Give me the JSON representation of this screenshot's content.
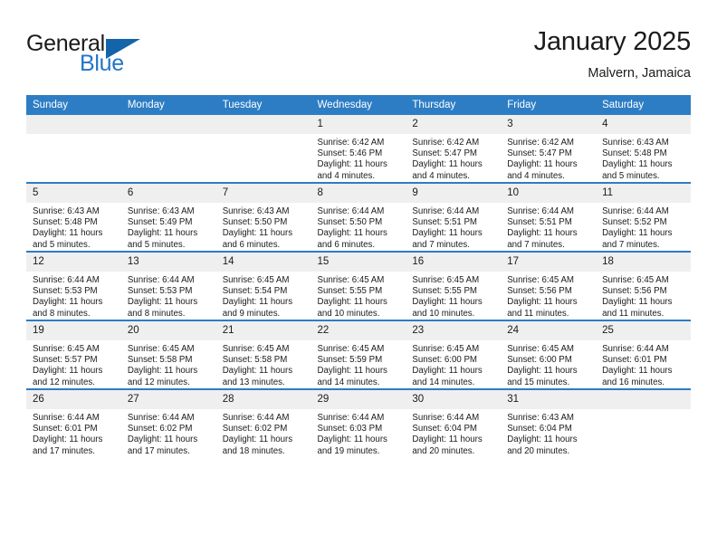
{
  "brand": {
    "name_part1": "General",
    "name_part2": "Blue",
    "triangle_icon": "triangle-icon",
    "accent_color": "#2176c7",
    "triangle_color": "#1464aa"
  },
  "header": {
    "title": "January 2025",
    "subtitle": "Malvern, Jamaica"
  },
  "theme": {
    "header_blue": "#2d7dc4",
    "daynum_band": "#efefef",
    "text": "#1b1b1b"
  },
  "weekday_headers": [
    "Sunday",
    "Monday",
    "Tuesday",
    "Wednesday",
    "Thursday",
    "Friday",
    "Saturday"
  ],
  "labels": {
    "sunrise": "Sunrise:",
    "sunset": "Sunset:",
    "daylight": "Daylight:"
  },
  "weeks": [
    [
      {
        "day": "",
        "sunrise": "",
        "sunset": "",
        "daylight1": "",
        "daylight2": ""
      },
      {
        "day": "",
        "sunrise": "",
        "sunset": "",
        "daylight1": "",
        "daylight2": ""
      },
      {
        "day": "",
        "sunrise": "",
        "sunset": "",
        "daylight1": "",
        "daylight2": ""
      },
      {
        "day": "1",
        "sunrise": "Sunrise: 6:42 AM",
        "sunset": "Sunset: 5:46 PM",
        "daylight1": "Daylight: 11 hours",
        "daylight2": "and 4 minutes."
      },
      {
        "day": "2",
        "sunrise": "Sunrise: 6:42 AM",
        "sunset": "Sunset: 5:47 PM",
        "daylight1": "Daylight: 11 hours",
        "daylight2": "and 4 minutes."
      },
      {
        "day": "3",
        "sunrise": "Sunrise: 6:42 AM",
        "sunset": "Sunset: 5:47 PM",
        "daylight1": "Daylight: 11 hours",
        "daylight2": "and 4 minutes."
      },
      {
        "day": "4",
        "sunrise": "Sunrise: 6:43 AM",
        "sunset": "Sunset: 5:48 PM",
        "daylight1": "Daylight: 11 hours",
        "daylight2": "and 5 minutes."
      }
    ],
    [
      {
        "day": "5",
        "sunrise": "Sunrise: 6:43 AM",
        "sunset": "Sunset: 5:48 PM",
        "daylight1": "Daylight: 11 hours",
        "daylight2": "and 5 minutes."
      },
      {
        "day": "6",
        "sunrise": "Sunrise: 6:43 AM",
        "sunset": "Sunset: 5:49 PM",
        "daylight1": "Daylight: 11 hours",
        "daylight2": "and 5 minutes."
      },
      {
        "day": "7",
        "sunrise": "Sunrise: 6:43 AM",
        "sunset": "Sunset: 5:50 PM",
        "daylight1": "Daylight: 11 hours",
        "daylight2": "and 6 minutes."
      },
      {
        "day": "8",
        "sunrise": "Sunrise: 6:44 AM",
        "sunset": "Sunset: 5:50 PM",
        "daylight1": "Daylight: 11 hours",
        "daylight2": "and 6 minutes."
      },
      {
        "day": "9",
        "sunrise": "Sunrise: 6:44 AM",
        "sunset": "Sunset: 5:51 PM",
        "daylight1": "Daylight: 11 hours",
        "daylight2": "and 7 minutes."
      },
      {
        "day": "10",
        "sunrise": "Sunrise: 6:44 AM",
        "sunset": "Sunset: 5:51 PM",
        "daylight1": "Daylight: 11 hours",
        "daylight2": "and 7 minutes."
      },
      {
        "day": "11",
        "sunrise": "Sunrise: 6:44 AM",
        "sunset": "Sunset: 5:52 PM",
        "daylight1": "Daylight: 11 hours",
        "daylight2": "and 7 minutes."
      }
    ],
    [
      {
        "day": "12",
        "sunrise": "Sunrise: 6:44 AM",
        "sunset": "Sunset: 5:53 PM",
        "daylight1": "Daylight: 11 hours",
        "daylight2": "and 8 minutes."
      },
      {
        "day": "13",
        "sunrise": "Sunrise: 6:44 AM",
        "sunset": "Sunset: 5:53 PM",
        "daylight1": "Daylight: 11 hours",
        "daylight2": "and 8 minutes."
      },
      {
        "day": "14",
        "sunrise": "Sunrise: 6:45 AM",
        "sunset": "Sunset: 5:54 PM",
        "daylight1": "Daylight: 11 hours",
        "daylight2": "and 9 minutes."
      },
      {
        "day": "15",
        "sunrise": "Sunrise: 6:45 AM",
        "sunset": "Sunset: 5:55 PM",
        "daylight1": "Daylight: 11 hours",
        "daylight2": "and 10 minutes."
      },
      {
        "day": "16",
        "sunrise": "Sunrise: 6:45 AM",
        "sunset": "Sunset: 5:55 PM",
        "daylight1": "Daylight: 11 hours",
        "daylight2": "and 10 minutes."
      },
      {
        "day": "17",
        "sunrise": "Sunrise: 6:45 AM",
        "sunset": "Sunset: 5:56 PM",
        "daylight1": "Daylight: 11 hours",
        "daylight2": "and 11 minutes."
      },
      {
        "day": "18",
        "sunrise": "Sunrise: 6:45 AM",
        "sunset": "Sunset: 5:56 PM",
        "daylight1": "Daylight: 11 hours",
        "daylight2": "and 11 minutes."
      }
    ],
    [
      {
        "day": "19",
        "sunrise": "Sunrise: 6:45 AM",
        "sunset": "Sunset: 5:57 PM",
        "daylight1": "Daylight: 11 hours",
        "daylight2": "and 12 minutes."
      },
      {
        "day": "20",
        "sunrise": "Sunrise: 6:45 AM",
        "sunset": "Sunset: 5:58 PM",
        "daylight1": "Daylight: 11 hours",
        "daylight2": "and 12 minutes."
      },
      {
        "day": "21",
        "sunrise": "Sunrise: 6:45 AM",
        "sunset": "Sunset: 5:58 PM",
        "daylight1": "Daylight: 11 hours",
        "daylight2": "and 13 minutes."
      },
      {
        "day": "22",
        "sunrise": "Sunrise: 6:45 AM",
        "sunset": "Sunset: 5:59 PM",
        "daylight1": "Daylight: 11 hours",
        "daylight2": "and 14 minutes."
      },
      {
        "day": "23",
        "sunrise": "Sunrise: 6:45 AM",
        "sunset": "Sunset: 6:00 PM",
        "daylight1": "Daylight: 11 hours",
        "daylight2": "and 14 minutes."
      },
      {
        "day": "24",
        "sunrise": "Sunrise: 6:45 AM",
        "sunset": "Sunset: 6:00 PM",
        "daylight1": "Daylight: 11 hours",
        "daylight2": "and 15 minutes."
      },
      {
        "day": "25",
        "sunrise": "Sunrise: 6:44 AM",
        "sunset": "Sunset: 6:01 PM",
        "daylight1": "Daylight: 11 hours",
        "daylight2": "and 16 minutes."
      }
    ],
    [
      {
        "day": "26",
        "sunrise": "Sunrise: 6:44 AM",
        "sunset": "Sunset: 6:01 PM",
        "daylight1": "Daylight: 11 hours",
        "daylight2": "and 17 minutes."
      },
      {
        "day": "27",
        "sunrise": "Sunrise: 6:44 AM",
        "sunset": "Sunset: 6:02 PM",
        "daylight1": "Daylight: 11 hours",
        "daylight2": "and 17 minutes."
      },
      {
        "day": "28",
        "sunrise": "Sunrise: 6:44 AM",
        "sunset": "Sunset: 6:02 PM",
        "daylight1": "Daylight: 11 hours",
        "daylight2": "and 18 minutes."
      },
      {
        "day": "29",
        "sunrise": "Sunrise: 6:44 AM",
        "sunset": "Sunset: 6:03 PM",
        "daylight1": "Daylight: 11 hours",
        "daylight2": "and 19 minutes."
      },
      {
        "day": "30",
        "sunrise": "Sunrise: 6:44 AM",
        "sunset": "Sunset: 6:04 PM",
        "daylight1": "Daylight: 11 hours",
        "daylight2": "and 20 minutes."
      },
      {
        "day": "31",
        "sunrise": "Sunrise: 6:43 AM",
        "sunset": "Sunset: 6:04 PM",
        "daylight1": "Daylight: 11 hours",
        "daylight2": "and 20 minutes."
      },
      {
        "day": "",
        "sunrise": "",
        "sunset": "",
        "daylight1": "",
        "daylight2": ""
      }
    ]
  ]
}
